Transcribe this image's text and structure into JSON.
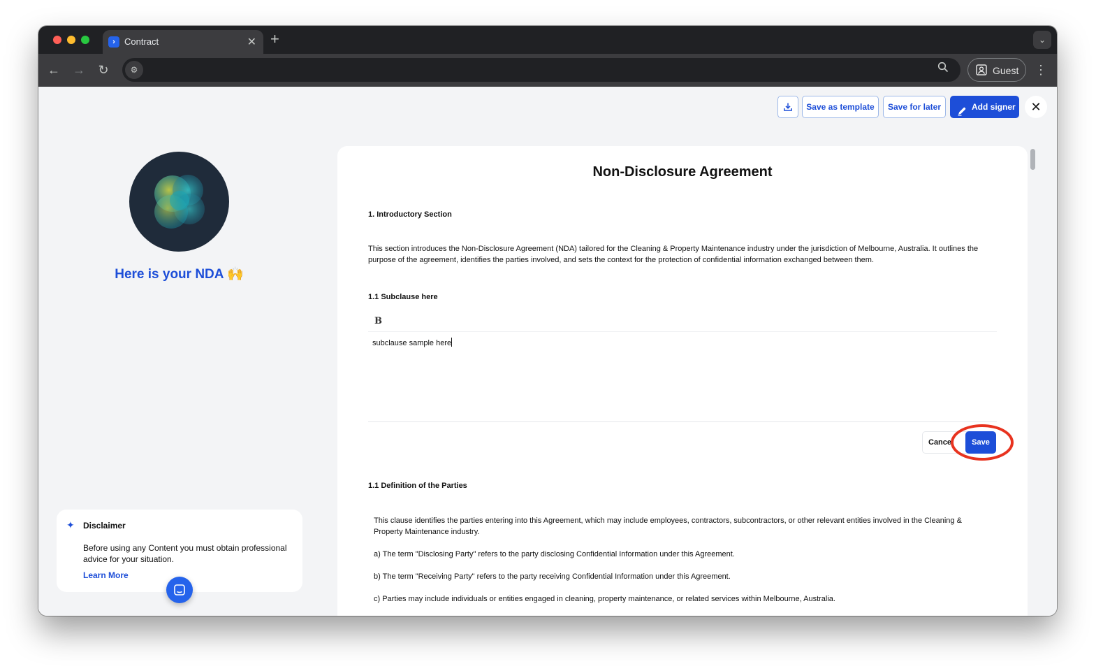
{
  "browser": {
    "tab_title": "Contract",
    "tab_favicon": "app-logo-icon",
    "profile_label": "Guest",
    "url": ""
  },
  "top_actions": {
    "download_icon": "download-icon",
    "save_as_template": "Save as template",
    "save_for_later": "Save for later",
    "add_signer": "Add signer",
    "close_icon": "close-icon"
  },
  "left_panel": {
    "heading": "Here is your NDA",
    "heading_emoji": "raised-hands-icon",
    "disclaimer": {
      "title": "Disclaimer",
      "body": "Before using any Content you must obtain professional advice for your situation.",
      "link": "Learn More"
    }
  },
  "document": {
    "title": "Non-Disclosure Agreement",
    "section1_heading": "1. Introductory Section",
    "section1_body": "This section introduces the Non-Disclosure Agreement (NDA) tailored for the Cleaning & Property Maintenance industry under the jurisdiction of Melbourne, Australia. It outlines the purpose of the agreement, identifies the parties involved, and sets the context for the protection of confidential information exchanged between them.",
    "subclause_heading": "1.1 Subclause here",
    "editor_bold_button": "B",
    "editor_text": "subclause sample here",
    "cancel_label": "Cancel",
    "save_label": "Save",
    "definition_heading": "1.1 Definition of the Parties",
    "definition_body": "This clause identifies the parties entering into this Agreement, which may include employees, contractors, subcontractors, or other relevant entities involved in the Cleaning & Property Maintenance industry.",
    "item_a": "a) The term \"Disclosing Party\" refers to the party disclosing Confidential Information under this Agreement.",
    "item_b": "b) The term \"Receiving Party\" refers to the party receiving Confidential Information under this Agreement.",
    "item_c": "c) Parties may include individuals or entities engaged in cleaning, property maintenance, or related services within Melbourne, Australia."
  },
  "colors": {
    "accent": "#1d4ed8",
    "highlight": "#e8331f",
    "page_bg": "#f3f4f6"
  }
}
